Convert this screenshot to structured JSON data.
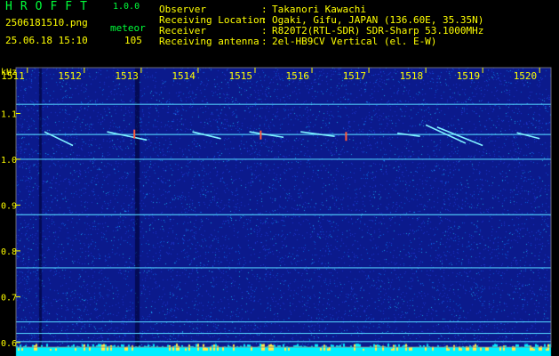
{
  "app": {
    "title": "HROFFT",
    "version": "1.0.0"
  },
  "file": {
    "name": "2506181510.png",
    "datetime": "25.06.18 15:10",
    "mode_label": "meteor",
    "count": "105"
  },
  "info": {
    "rows": [
      {
        "label": "Observer",
        "value": "Takanori Kawachi"
      },
      {
        "label": "Receiving Location",
        "value": "Ogaki, Gifu, JAPAN (136.60E, 35.35N)"
      },
      {
        "label": "Receiver",
        "value": "R820T2(RTL-SDR) SDR-Sharp 53.1000MHz"
      },
      {
        "label": "Receiving antenna",
        "value": "2el-HB9CV Vertical (el. E-W)"
      }
    ],
    "separator": ":"
  },
  "colors": {
    "header_green": "#00ff3a",
    "header_yellow": "#ffff00",
    "background_blue": "#0b1a8c",
    "grid_cyan": "#55d6ff",
    "baseline_cyan": "#00eeff"
  },
  "chart_data": {
    "type": "heatmap",
    "y_unit_label": "kHz",
    "x_ticks": [
      "1511",
      "1512",
      "1513",
      "1514",
      "1515",
      "1516",
      "1517",
      "1518",
      "1519",
      "1520"
    ],
    "y_ticks": [
      "1.1",
      "1.0",
      "0.9",
      "0.8",
      "0.7",
      "0.6"
    ],
    "ylim": [
      0.59,
      1.2
    ],
    "xlim": [
      1510.8,
      1520.2
    ],
    "horizontal_carriers_khz": [
      1.12,
      1.054,
      1.0,
      0.879,
      0.763,
      0.645,
      0.62,
      0.602
    ],
    "meteor_traces": [
      {
        "x_start": 1511.3,
        "x_end": 1511.8,
        "y_start": 1.06,
        "y_end": 1.03
      },
      {
        "x_start": 1512.4,
        "x_end": 1513.1,
        "y_start": 1.06,
        "y_end": 1.042
      },
      {
        "x_start": 1513.9,
        "x_end": 1514.4,
        "y_start": 1.06,
        "y_end": 1.045
      },
      {
        "x_start": 1514.9,
        "x_end": 1515.5,
        "y_start": 1.06,
        "y_end": 1.048
      },
      {
        "x_start": 1515.8,
        "x_end": 1516.4,
        "y_start": 1.06,
        "y_end": 1.05
      },
      {
        "x_start": 1517.5,
        "x_end": 1517.9,
        "y_start": 1.057,
        "y_end": 1.05
      },
      {
        "x_start": 1518.0,
        "x_end": 1518.7,
        "y_start": 1.075,
        "y_end": 1.035
      },
      {
        "x_start": 1518.2,
        "x_end": 1519.0,
        "y_start": 1.07,
        "y_end": 1.03
      },
      {
        "x_start": 1519.6,
        "x_end": 1520.0,
        "y_start": 1.058,
        "y_end": 1.045
      }
    ],
    "meteor_heads": [
      {
        "x": 1512.88,
        "y": 1.055
      },
      {
        "x": 1515.1,
        "y": 1.053
      },
      {
        "x": 1516.6,
        "y": 1.05
      }
    ]
  }
}
